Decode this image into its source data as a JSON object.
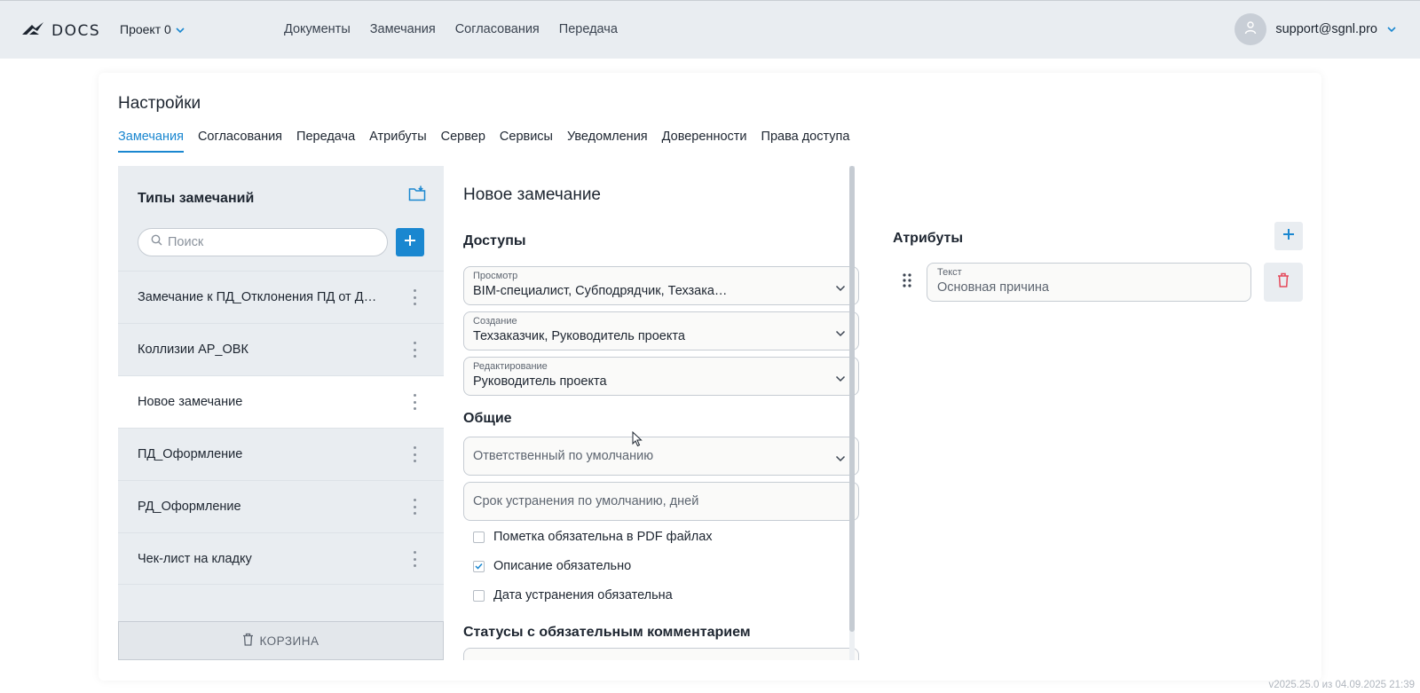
{
  "header": {
    "logo_text": "DOCS",
    "project_label": "Проект 0",
    "nav": [
      "Документы",
      "Замечания",
      "Согласования",
      "Передача"
    ],
    "user_email": "support@sgnl.pro"
  },
  "page": {
    "title": "Настройки",
    "tabs": [
      "Замечания",
      "Согласования",
      "Передача",
      "Атрибуты",
      "Сервер",
      "Сервисы",
      "Уведомления",
      "Доверенности",
      "Права доступа"
    ],
    "active_tab": "Замечания"
  },
  "sidebar": {
    "title": "Типы замечаний",
    "search_placeholder": "Поиск",
    "items": [
      "Замечание к ПД_Отклонения ПД от Договора",
      "Коллизии АР_ОВК",
      "Новое замечание",
      "ПД_Оформление",
      "РД_Оформление",
      "Чек-лист на кладку"
    ],
    "active_item": "Новое замечание",
    "trash_label": "КОРЗИНА"
  },
  "editor": {
    "title": "Новое замечание",
    "access_section": "Доступы",
    "access_fields": [
      {
        "label": "Просмотр",
        "value": "BIM-специалист, Субподрядчик, Техзаказчик, Руководитель проекта"
      },
      {
        "label": "Создание",
        "value": "Техзаказчик, Руководитель проекта"
      },
      {
        "label": "Редактирование",
        "value": "Руководитель проекта"
      }
    ],
    "general_section": "Общие",
    "responsible_placeholder": "Ответственный по умолчанию",
    "deadline_placeholder": "Срок устранения по умолчанию, дней",
    "checkboxes": [
      {
        "label": "Пометка обязательна в PDF файлах",
        "checked": false
      },
      {
        "label": "Описание обязательно",
        "checked": true
      },
      {
        "label": "Дата устранения обязательна",
        "checked": false
      }
    ],
    "statuses_section": "Статусы с обязательным комментарием"
  },
  "attributes": {
    "title": "Атрибуты",
    "items": [
      {
        "label": "Текст",
        "value": "Основная причина"
      }
    ]
  },
  "version": "v2025.25.0 из 04.09.2025 21:39",
  "colors": {
    "accent": "#1a87d0",
    "header_bg": "#e9edf1",
    "danger": "#e5485a"
  }
}
